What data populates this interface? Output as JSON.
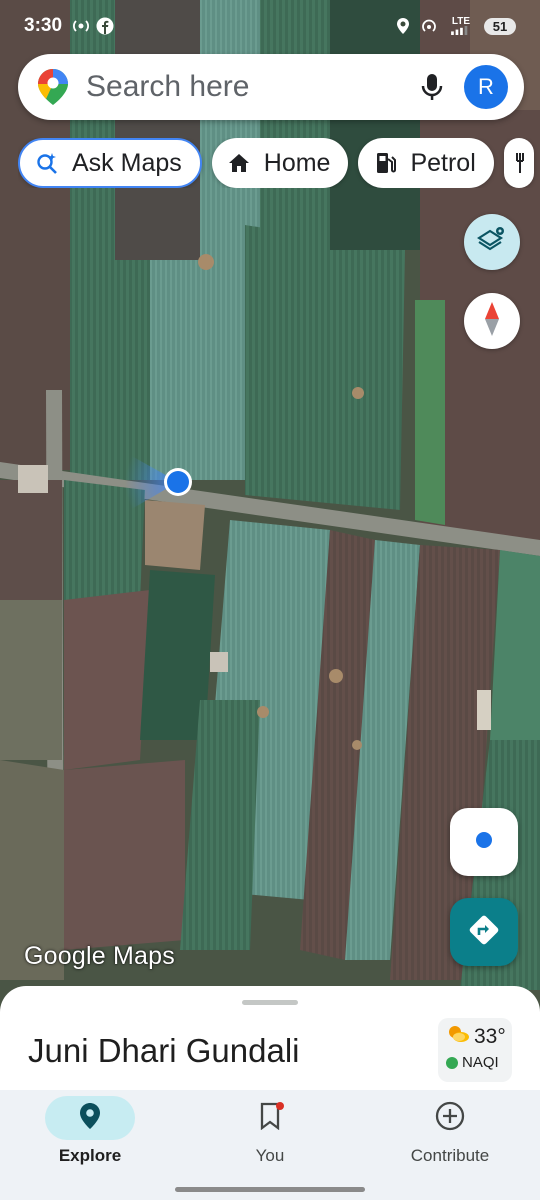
{
  "status_bar": {
    "time": "3:30",
    "network": "LTE",
    "battery": "51"
  },
  "search": {
    "placeholder": "Search here",
    "avatar_initial": "R"
  },
  "chips": [
    {
      "label": "Ask Maps",
      "icon": "ask-maps-sparkle-icon"
    },
    {
      "label": "Home",
      "icon": "home-icon"
    },
    {
      "label": "Petrol",
      "icon": "fuel-pump-icon"
    },
    {
      "label": "",
      "icon": "restaurant-icon"
    }
  ],
  "map": {
    "watermark": "Google Maps",
    "type": "satellite"
  },
  "sheet": {
    "place_name": "Juni Dhari Gundali",
    "weather": {
      "temperature": "33°",
      "aqi_label": "NAQI",
      "aqi_color": "#34a853"
    }
  },
  "bottom_nav": {
    "items": [
      {
        "label": "Explore",
        "icon": "explore-pin-icon",
        "active": true
      },
      {
        "label": "You",
        "icon": "bookmark-icon",
        "active": false,
        "badge": true
      },
      {
        "label": "Contribute",
        "icon": "add-circle-icon",
        "active": false
      }
    ]
  },
  "colors": {
    "accent_blue": "#1a73e8",
    "directions_teal": "#0b7f8a",
    "layers_bg": "#c8e9f0",
    "nav_active_bg": "#c7ecf2"
  }
}
